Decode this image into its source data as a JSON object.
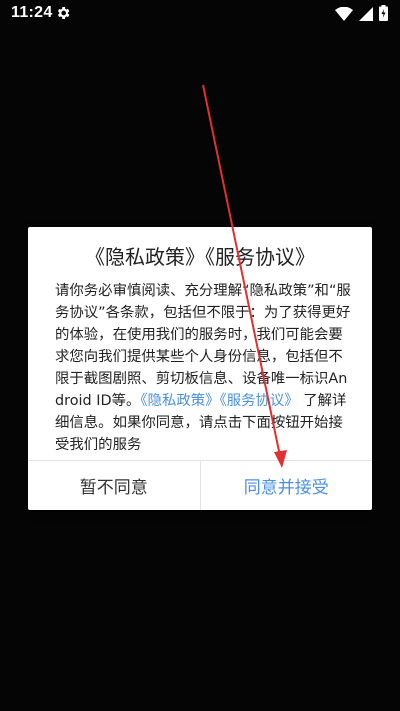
{
  "status_bar": {
    "time": "11:24",
    "settings_icon": "gear-icon",
    "wifi_icon": "wifi-icon",
    "signal_icon": "signal-icon",
    "battery_icon": "battery-charging-icon"
  },
  "dialog": {
    "title": "《隐私政策》《服务协议》",
    "body_part1": "请你务必审慎阅读、充分理解“隐私政策”和“服务协议”各条款，包括但不限于：为了获得更好的体验，在使用我们的服务时，我们可能会要求您向我们提供某些个人身份信息，包括但不限于截图剧照、剪切板信息、设备唯一标识Android ID等。",
    "link_privacy": "《隐私政策》",
    "link_service": "《服务协议》",
    "body_part2": "了解详细信息。如果你同意，请点击下面按钮开始接受我们的服务",
    "disagree_label": "暂不同意",
    "agree_label": "同意并接受"
  },
  "colors": {
    "link": "#4a90e2",
    "arrow": "#e03030",
    "background": "#050505"
  }
}
